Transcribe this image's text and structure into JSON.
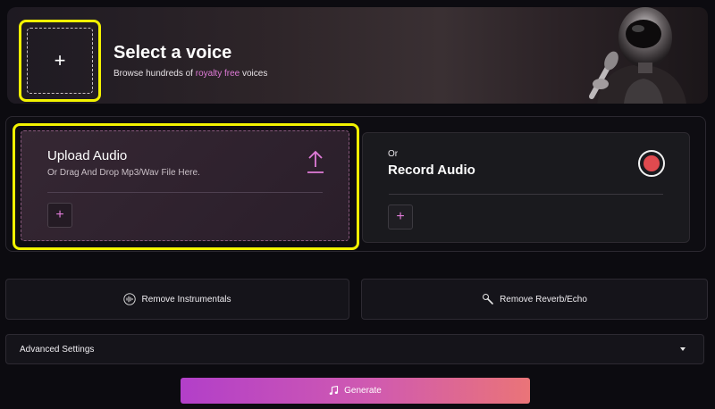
{
  "voice": {
    "title": "Select a voice",
    "subtitle_before": "Browse hundreds of",
    "subtitle_highlight": "royalty free",
    "subtitle_after": "voices",
    "add_icon": "plus-icon"
  },
  "upload": {
    "title": "Upload Audio",
    "subtitle": "Or Drag And Drop Mp3/Wav File Here.",
    "upload_icon": "upload-arrow-icon",
    "add_icon": "plus-icon"
  },
  "record": {
    "or_label": "Or",
    "title": "Record Audio",
    "record_icon": "record-icon",
    "add_icon": "plus-icon"
  },
  "features": {
    "remove_instrumentals": "Remove Instrumentals",
    "remove_instrumentals_icon": "waveform-icon",
    "remove_reverb": "Remove Reverb/Echo",
    "remove_reverb_icon": "microphone-icon"
  },
  "advanced": {
    "label": "Advanced Settings",
    "icon": "caret-down-icon"
  },
  "generate": {
    "label": "Generate",
    "icon": "music-note-icon"
  },
  "colors": {
    "highlight_outline": "#f2f200",
    "accent_pink": "#e07bd8",
    "record_red": "#e04a4f",
    "generate_gradient_start": "#b23fc9",
    "generate_gradient_end": "#ea7478"
  }
}
